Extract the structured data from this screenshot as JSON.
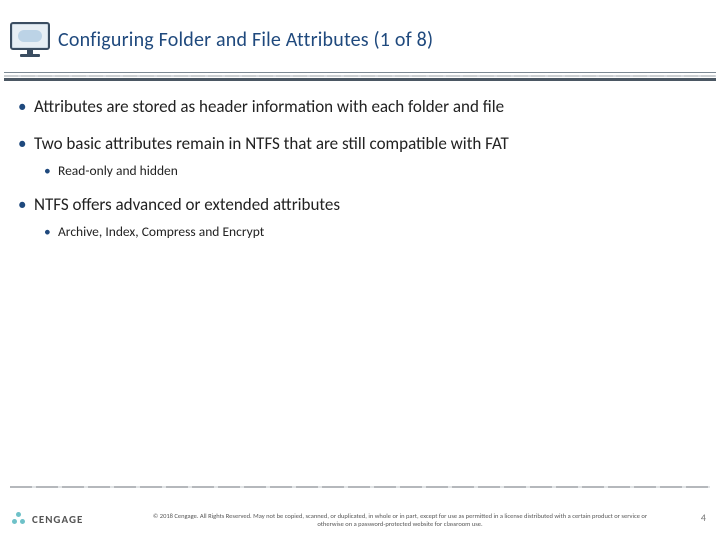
{
  "title": "Configuring Folder and File Attributes (1 of 8)",
  "bullets": {
    "b1": "Attributes are stored as header information with each folder and file",
    "b2": "Two basic attributes remain in NTFS that are still compatible with FAT",
    "b2_1": "Read-only and hidden",
    "b3": "NTFS offers advanced or extended attributes",
    "b3_1": "Archive, Index, Compress and Encrypt"
  },
  "footer": {
    "brand": "CENGAGE",
    "copyright": "© 2018 Cengage. All Rights Reserved. May not be copied, scanned, or duplicated, in whole or in part, except for use as permitted in a license distributed with a certain product or service or otherwise on a password-protected website for classroom use.",
    "page": "4"
  }
}
